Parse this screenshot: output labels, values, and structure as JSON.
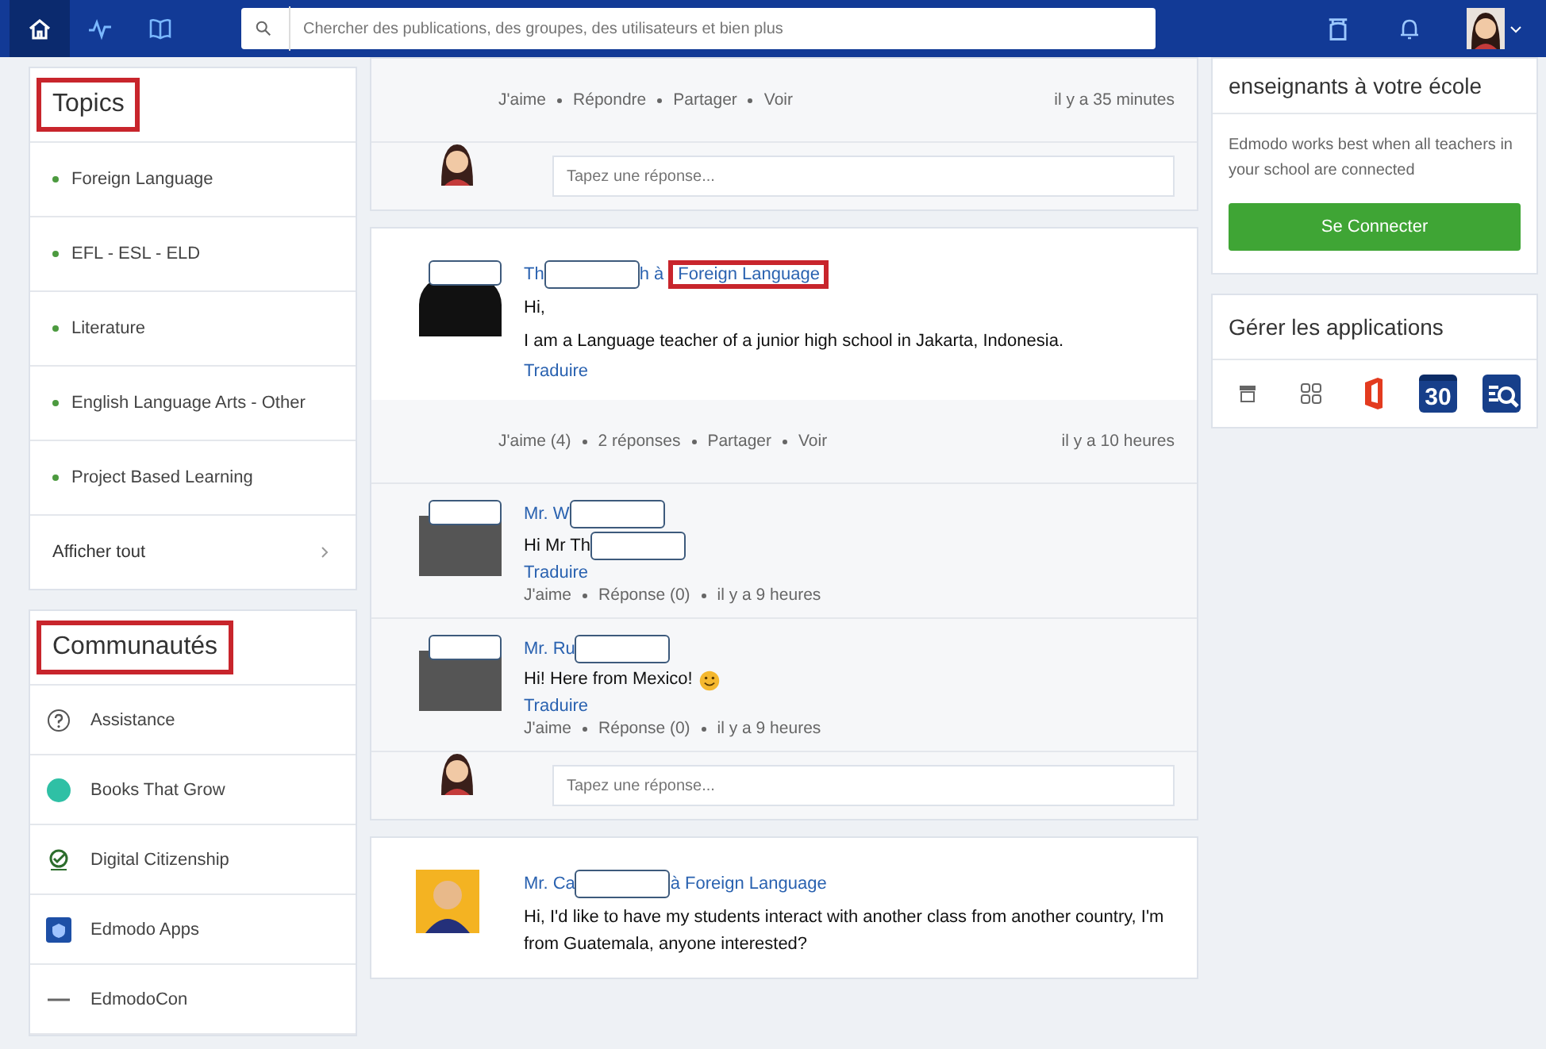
{
  "topbar": {
    "search_placeholder": "Chercher des publications, des groupes, des utilisateurs et bien plus"
  },
  "topics": {
    "title": "Topics",
    "highlighted": true,
    "items": [
      "Foreign Language",
      "EFL - ESL - ELD",
      "Literature",
      "English Language Arts - Other",
      "Project Based Learning"
    ],
    "show_all": "Afficher tout"
  },
  "communities": {
    "title": "Communautés",
    "highlighted": true,
    "items": [
      {
        "label": "Assistance",
        "kind": "help"
      },
      {
        "label": "Books That Grow",
        "kind": "books"
      },
      {
        "label": "Digital Citizenship",
        "kind": "check"
      },
      {
        "label": "Edmodo Apps",
        "kind": "apps"
      },
      {
        "label": "EdmodoCon",
        "kind": "dash"
      }
    ]
  },
  "posts": [
    {
      "kind": "partial",
      "actions": [
        "J'aime",
        "Répondre",
        "Partager",
        "Voir"
      ],
      "time": "il y a 35 minutes",
      "reply_placeholder": "Tapez une réponse..."
    },
    {
      "kind": "full",
      "avatar": {
        "kind": "silhouette",
        "redacted": true
      },
      "name_parts": [
        {
          "kind": "text",
          "text": "Th"
        },
        {
          "kind": "redacted"
        },
        {
          "kind": "text",
          "text": "h à"
        }
      ],
      "group": "Foreign Language",
      "group_highlighted": true,
      "body": [
        "Hi,",
        "I am a Language teacher of a junior high school in Jakarta, Indonesia."
      ],
      "translate": "Traduire",
      "actions": [
        "J'aime (4)",
        "2 réponses",
        "Partager",
        "Voir"
      ],
      "time": "il y a 10 heures",
      "replies": [
        {
          "avatar": {
            "kind": "photo",
            "redacted": true
          },
          "name_parts": [
            {
              "kind": "text",
              "text": "Mr. W"
            },
            {
              "kind": "redacted"
            }
          ],
          "body_parts": [
            {
              "kind": "text",
              "text": "Hi Mr Th"
            },
            {
              "kind": "redacted"
            }
          ],
          "translate": "Traduire",
          "meta": [
            "J'aime",
            "Réponse (0)",
            "il y a 9 heures"
          ]
        },
        {
          "avatar": {
            "kind": "photo",
            "redacted": true
          },
          "name_parts": [
            {
              "kind": "text",
              "text": "Mr. Ru"
            },
            {
              "kind": "redacted"
            }
          ],
          "body_parts": [
            {
              "kind": "text",
              "text": "Hi! Here from Mexico!"
            },
            {
              "kind": "smiley"
            }
          ],
          "translate": "Traduire",
          "meta": [
            "J'aime",
            "Réponse (0)",
            "il y a 9 heures"
          ]
        }
      ],
      "reply_placeholder": "Tapez une réponse..."
    },
    {
      "kind": "full",
      "avatar": {
        "kind": "cartoon",
        "redacted": false
      },
      "name_parts": [
        {
          "kind": "text",
          "text": "Mr. Ca"
        },
        {
          "kind": "redacted"
        },
        {
          "kind": "text",
          "text": "à"
        }
      ],
      "group": "Foreign Language",
      "group_highlighted": false,
      "body": [
        "Hi, I'd like to have my students interact with another class from another country, I'm from Guatemala, anyone interested?"
      ]
    }
  ],
  "invite": {
    "title": "enseignants à votre école",
    "text": "Edmodo works best when all teachers in your school are connected",
    "button": "Se Connecter"
  },
  "apps": {
    "title": "Gérer les applications",
    "items": [
      {
        "kind": "store"
      },
      {
        "kind": "grid"
      },
      {
        "kind": "office"
      },
      {
        "kind": "calendar",
        "text": "30"
      },
      {
        "kind": "search"
      }
    ]
  }
}
